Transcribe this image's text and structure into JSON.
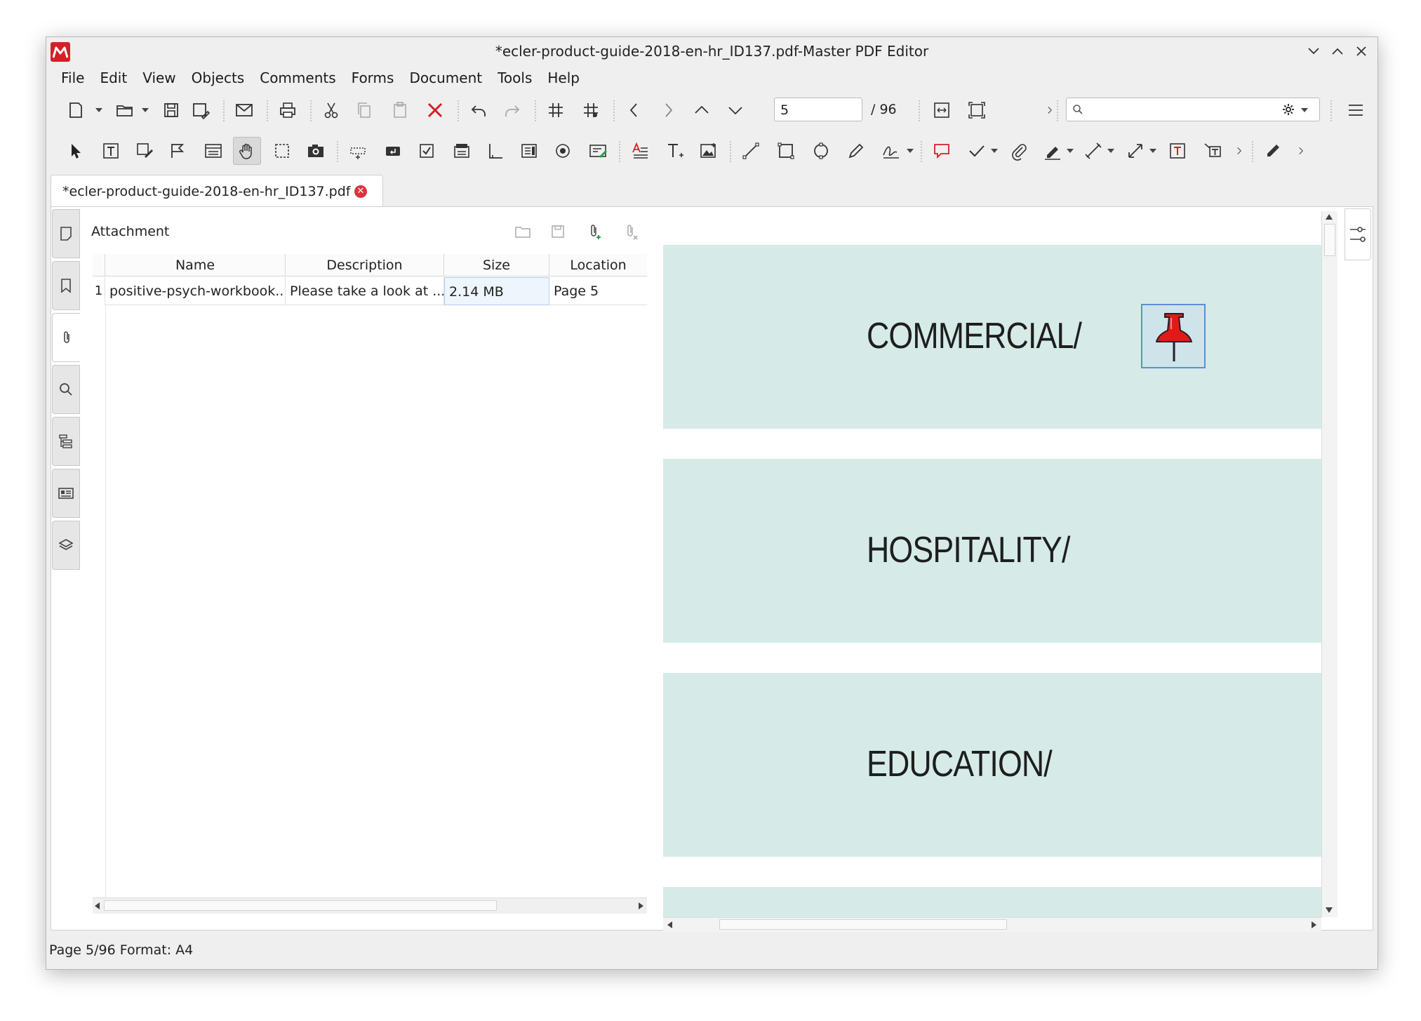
{
  "window": {
    "title": "*ecler-product-guide-2018-en-hr_ID137.pdf-Master PDF Editor"
  },
  "menu": [
    "File",
    "Edit",
    "View",
    "Objects",
    "Comments",
    "Forms",
    "Document",
    "Tools",
    "Help"
  ],
  "navigation": {
    "current_page": "5",
    "total_pages": "/ 96"
  },
  "search": {
    "placeholder": ""
  },
  "tab": {
    "label": "*ecler-product-guide-2018-en-hr_ID137.pdf"
  },
  "attachment_panel": {
    "title": "Attachment",
    "columns": [
      "Name",
      "Description",
      "Size",
      "Location"
    ],
    "rows": [
      {
        "index": "1",
        "name": "positive-psych-workbook...",
        "description": "Please take a look at ...",
        "size": "2.14 MB",
        "location": "Page 5"
      }
    ]
  },
  "pdf_page": {
    "sections": [
      "COMMERCIAL/",
      "HOSPITALITY/",
      "EDUCATION/"
    ],
    "band_color": "#d6ebe7"
  },
  "status": {
    "text": "Page 5/96 Format: A4"
  },
  "colors": {
    "accent_red": "#d32027",
    "selection_blue": "#5a8fd6"
  }
}
